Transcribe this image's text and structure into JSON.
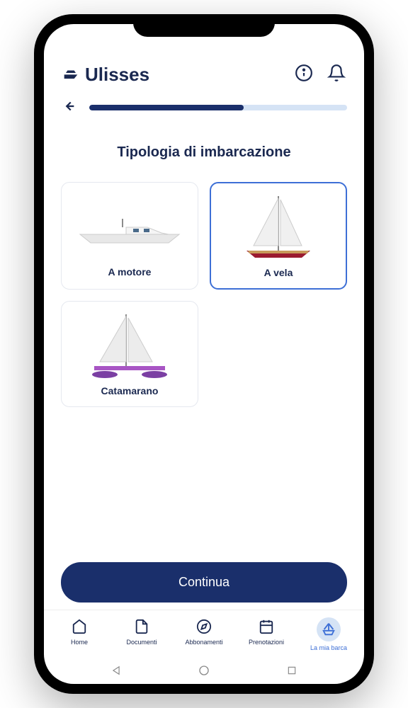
{
  "header": {
    "brand": "Ulisses"
  },
  "progress": {
    "percent": 60
  },
  "page": {
    "title": "Tipologia di imbarcazione"
  },
  "options": [
    {
      "id": "motorboat",
      "label": "A motore",
      "selected": false
    },
    {
      "id": "sailboat",
      "label": "A vela",
      "selected": true
    },
    {
      "id": "catamaran",
      "label": "Catamarano",
      "selected": false
    }
  ],
  "cta": {
    "continue": "Continua"
  },
  "nav": [
    {
      "id": "home",
      "label": "Home",
      "active": false
    },
    {
      "id": "documenti",
      "label": "Documenti",
      "active": false
    },
    {
      "id": "abbonamenti",
      "label": "Abbonamenti",
      "active": false
    },
    {
      "id": "prenotazioni",
      "label": "Prenotazioni",
      "active": false
    },
    {
      "id": "miabarca",
      "label": "La mia barca",
      "active": true
    }
  ]
}
